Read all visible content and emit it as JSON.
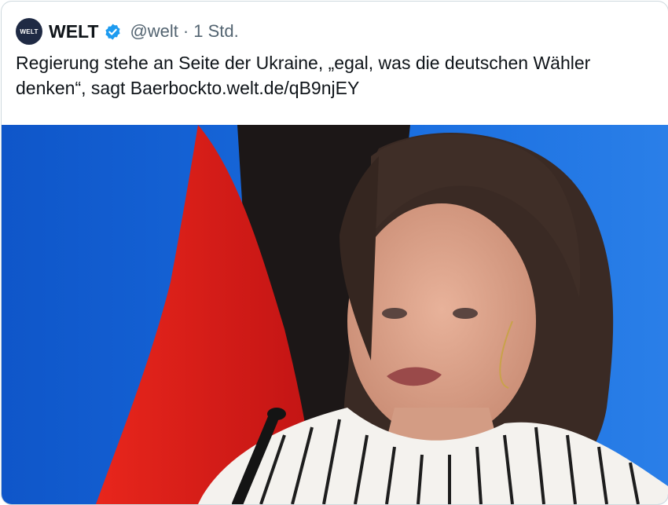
{
  "tweet": {
    "avatar_text": "WELT",
    "display_name": "WELT",
    "handle": "@welt",
    "separator": "·",
    "timestamp": "1 Std.",
    "text_part1": "Regierung stehe an Seite der Ukraine, „egal, was die deutschen Wähler denken“, sagt Baerbock",
    "link": "to.welt.de/qB9njEY"
  },
  "colors": {
    "verified_badge": "#1d9bf0",
    "flag_red": "#dd1a1a",
    "flag_black": "#1a1a1a",
    "background_blue": "#1565d8"
  },
  "icons": {
    "verified": "verified-badge-icon"
  }
}
